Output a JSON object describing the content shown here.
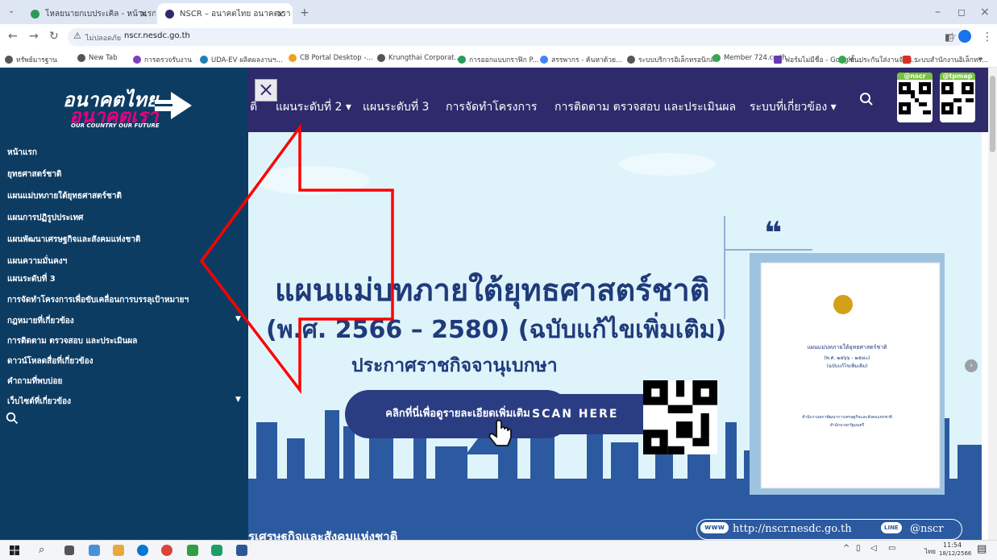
{
  "browser": {
    "tabs": [
      {
        "title": "โหลยนายกเบประเคิล - หน้าแรก",
        "active": false
      },
      {
        "title": "NSCR – อนาคตไทย อนาคตเรา",
        "active": true
      }
    ],
    "new_tab": "+",
    "address": {
      "security": "ไม่ปลอดภัย",
      "url": "nscr.nesdc.go.th"
    },
    "bookmarks": [
      "ทรัพย์มารฐาน",
      "New Tab",
      "การตรวจรับงาน",
      "UDA-EV ผลิตผลงานฯ...",
      "CB Portal Desktop -...",
      "Krungthai Corporat...",
      "การออกแบบกราฟิก P...",
      "สรรพากร - ค้นหาด้วย...",
      "ระบบบริการอิเล็กทรอนิกส์",
      "Member 724.co.th",
      "ฟอร์มไม่มีชื่อ - Google...",
      "ขั้นประกันใส่งานจัดซ...",
      "ระบบสำนักงานอิเล็กทร..."
    ],
    "bookmarks_more": "»"
  },
  "site": {
    "logo": {
      "line1": "อนาคตไทย",
      "line2": "อนาคตเรา",
      "tagline": "OUR COUNTRY OUR FUTURE"
    },
    "close_icon": "×",
    "nav": [
      "ติ",
      "แผนระดับที่ 2 ▾",
      "แผนระดับที่ 3",
      "การจัดทำโครงการ",
      "การติดตาม ตรวจสอบ และประเมินผล",
      "ระบบที่เกี่ยวข้อง ▾"
    ],
    "qr_labels": [
      "@nscr",
      "@tpmap"
    ],
    "menu": [
      {
        "label": "หน้าแรก",
        "has_submenu": false
      },
      {
        "label": "ยุทธศาสตร์ชาติ",
        "has_submenu": false
      },
      {
        "label": "แผนแม่บทภายใต้ยุทธศาสตร์ชาติ",
        "has_submenu": false
      },
      {
        "label": "แผนการปฏิรูปประเทศ",
        "has_submenu": false
      },
      {
        "label": "แผนพัฒนาเศรษฐกิจและสังคมแห่งชาติ",
        "has_submenu": false
      },
      {
        "label": "แผนความมั่นคงฯ",
        "has_submenu": false
      },
      {
        "label": "แผนระดับที่ 3",
        "has_submenu": false
      },
      {
        "label": "การจัดทำโครงการเพื่อขับเคลื่อนการบรรลุเป้าหมายฯ",
        "has_submenu": false
      },
      {
        "label": "กฎหมายที่เกี่ยวข้อง",
        "has_submenu": true
      },
      {
        "label": "การติดตาม ตรวจสอบ และประเมินผล",
        "has_submenu": false
      },
      {
        "label": "ดาวน์โหลดสื่อที่เกี่ยวข้อง",
        "has_submenu": false
      },
      {
        "label": "คำถามที่พบบ่อย",
        "has_submenu": false
      },
      {
        "label": "เว็บไซต์ที่เกี่ยวข้อง",
        "has_submenu": true
      }
    ],
    "hero": {
      "title": "แผนแม่บทภายใต้ยุทธศาสตร์ชาติ",
      "subtitle": "(พ.ศ. 2566 – 2580) (ฉบับแก้ไขเพิ่มเติม)",
      "announce": "ประกาศราชกิจจานุเบกษา",
      "cta": "คลิกที่นี่เพื่อดูรายละเอียดเพิ่มเติม",
      "scan": "SCAN HERE",
      "footer_text": "รเศรษฐกิจและสังคมแห่งชาติ",
      "www": "www",
      "url": "http://nscr.nesdc.go.th",
      "line": "LINE",
      "line_id": "@nscr",
      "quote": "❝",
      "book": {
        "title": "แผนแม่บทภายใต้ยุทธศาสตร์ชาติ",
        "years": "(พ.ศ. ๒๕๖๖ - ๒๕๘๐)",
        "edition": "(ฉบับแก้ไขเพิ่มเติม)",
        "pub1": "สำนักงานสภาพัฒนาการเศรษฐกิจและสังคมแห่งชาติ",
        "pub2": "สำนักนายกรัฐมนตรี"
      },
      "slides": 10,
      "active_slide": 2
    }
  },
  "taskbar": {
    "time": "11:54",
    "date": "18/12/2566",
    "lang": "ไทย"
  },
  "colors": {
    "navy": "#2e2a6b",
    "drawer": "#0d3c63",
    "hero_bg": "#dff3fa",
    "arrow": "#ff0000",
    "cta": "#2b3d82"
  }
}
